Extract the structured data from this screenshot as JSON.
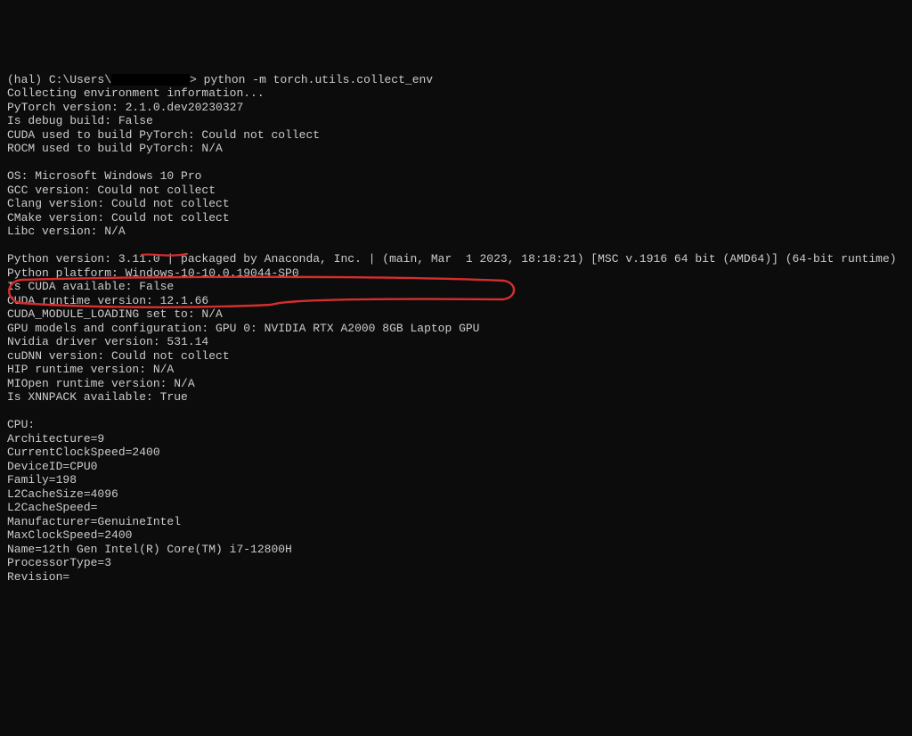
{
  "prompt": {
    "env": "(hal)",
    "path_prefix": "C:\\Users\\",
    "path_suffix": "> ",
    "command": "python -m torch.utils.collect_env"
  },
  "lines": [
    "Collecting environment information...",
    "PyTorch version: 2.1.0.dev20230327",
    "Is debug build: False",
    "CUDA used to build PyTorch: Could not collect",
    "ROCM used to build PyTorch: N/A",
    "",
    "OS: Microsoft Windows 10 Pro",
    "GCC version: Could not collect",
    "Clang version: Could not collect",
    "CMake version: Could not collect",
    "Libc version: N/A",
    "",
    "Python version: 3.11.0 | packaged by Anaconda, Inc. | (main, Mar  1 2023, 18:18:21) [MSC v.1916 64 bit (AMD64)] (64-bit runtime)",
    "Python platform: Windows-10-10.0.19044-SP0",
    "Is CUDA available: False",
    "CUDA runtime version: 12.1.66",
    "CUDA_MODULE_LOADING set to: N/A",
    "GPU models and configuration: GPU 0: NVIDIA RTX A2000 8GB Laptop GPU",
    "Nvidia driver version: 531.14",
    "cuDNN version: Could not collect",
    "HIP runtime version: N/A",
    "MIOpen runtime version: N/A",
    "Is XNNPACK available: True",
    "",
    "CPU:",
    "Architecture=9",
    "CurrentClockSpeed=2400",
    "DeviceID=CPU0",
    "Family=198",
    "L2CacheSize=4096",
    "L2CacheSpeed=",
    "Manufacturer=GenuineIntel",
    "MaxClockSpeed=2400",
    "Name=12th Gen Intel(R) Core(TM) i7-12800H",
    "ProcessorType=3",
    "Revision="
  ]
}
